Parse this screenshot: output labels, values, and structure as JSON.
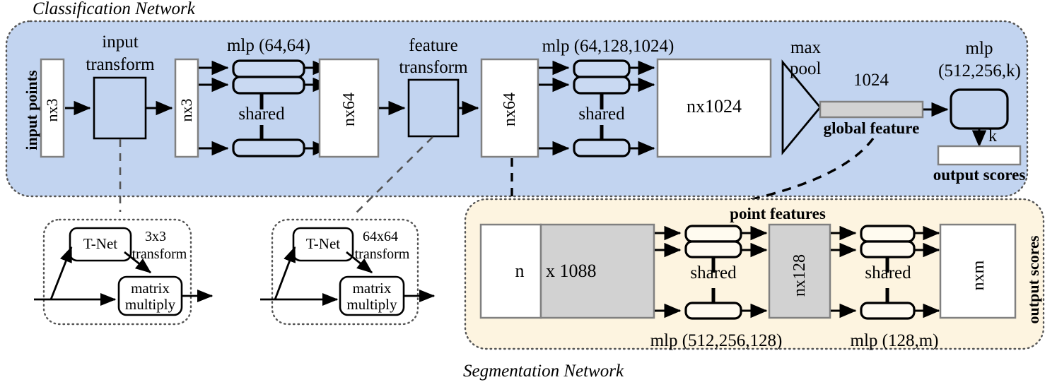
{
  "diagram": {
    "title_classification": "Classification Network",
    "title_segmentation": "Segmentation Network",
    "colors": {
      "classification_panel": "#c2d4f0",
      "segmentation_panel": "#fdf4e0",
      "mlp_block": "#c9d9f2",
      "gray_tensor": "#d2d2d2",
      "white_tensor": "#ffffff",
      "stroke": "#000000",
      "tensor_border": "#808080"
    }
  },
  "classification": {
    "panel_label_input_points": "input points",
    "tensor_nx3_a": "nx3",
    "input_transform_label_line1": "input",
    "input_transform_label_line2": "transform",
    "tensor_nx3_b": "nx3",
    "mlp_64_64": "mlp (64,64)",
    "shared_1": "shared",
    "tensor_nx64_a": "nx64",
    "feature_transform_line1": "feature",
    "feature_transform_line2": "transform",
    "tensor_nx64_b": "nx64",
    "mlp_64_128_1024": "mlp (64,128,1024)",
    "shared_2": "shared",
    "tensor_nx1024": "nx1024",
    "max_pool_line1": "max",
    "max_pool_line2": "pool",
    "global_feature_size": "1024",
    "global_feature_label": "global feature",
    "mlp_512_256_k_line1": "mlp",
    "mlp_512_256_k_line2": "(512,256,k)",
    "k_label": "k",
    "output_scores_label": "output scores"
  },
  "tnet_3x3": {
    "tnet_label": "T-Net",
    "transform_line1": "3x3",
    "transform_line2": "transform",
    "matmul_line1": "matrix",
    "matmul_line2": "multiply"
  },
  "tnet_64x64": {
    "tnet_label": "T-Net",
    "transform_line1": "64x64",
    "transform_line2": "transform",
    "matmul_line1": "matrix",
    "matmul_line2": "multiply"
  },
  "segmentation": {
    "point_features_label": "point features",
    "tensor_n": "n",
    "tensor_x1088": "x 1088",
    "shared_1": "shared",
    "mlp_512_256_128": "mlp (512,256,128)",
    "tensor_nx128": "nx128",
    "shared_2": "shared",
    "mlp_128_m": "mlp (128,m)",
    "tensor_nxm": "nxm",
    "output_scores_label": "output scores"
  }
}
